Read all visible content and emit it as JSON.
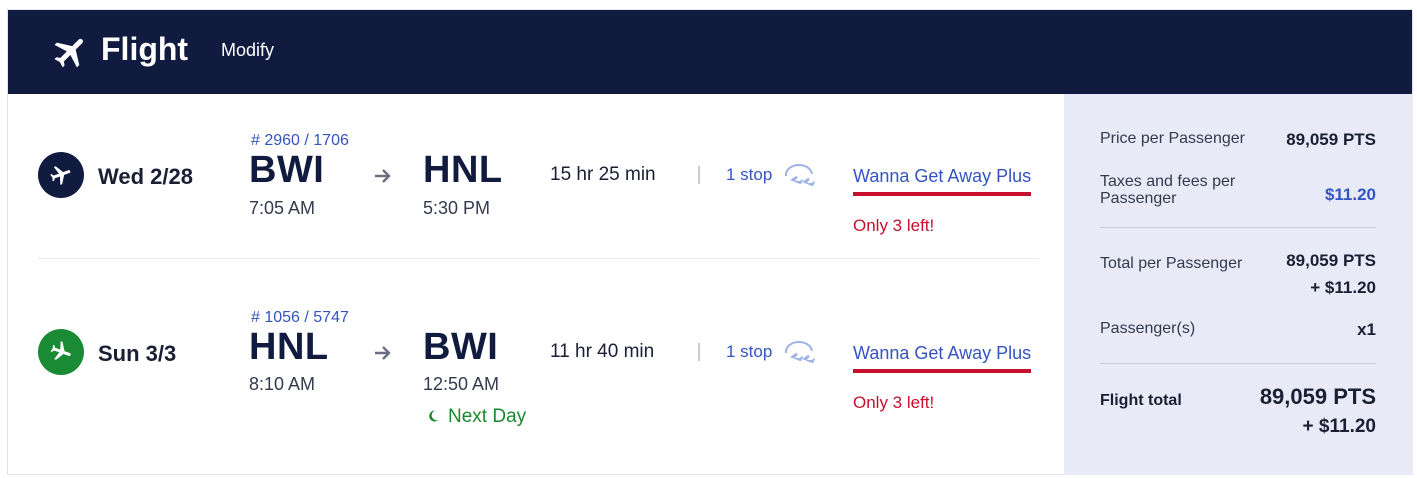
{
  "header": {
    "title": "Flight",
    "modify_label": "Modify",
    "icon": "airplane-icon"
  },
  "flights": [
    {
      "date": "Wed 2/28",
      "flight_number": "# 2960 / 1706",
      "origin": "BWI",
      "depart_time": "7:05 AM",
      "destination": "HNL",
      "arrive_time": "5:30 PM",
      "duration": "15 hr 25 min",
      "stops": "1 stop",
      "fare": "Wanna Get Away Plus",
      "seats_left": "Only 3 left!",
      "next_day": ""
    },
    {
      "date": "Sun 3/3",
      "flight_number": "# 1056 / 5747",
      "origin": "HNL",
      "depart_time": "8:10 AM",
      "destination": "BWI",
      "arrive_time": "12:50 AM",
      "duration": "11 hr 40 min",
      "stops": "1 stop",
      "fare": "Wanna Get Away Plus",
      "seats_left": "Only 3 left!",
      "next_day": "Next Day"
    }
  ],
  "summary": {
    "price_label": "Price per Passenger",
    "price_value": "89,059 PTS",
    "taxes_label": "Taxes and fees per Passenger",
    "taxes_value": "$11.20",
    "total_label": "Total per Passenger",
    "total_pts": "89,059 PTS",
    "total_cash": "+ $11.20",
    "passengers_label": "Passenger(s)",
    "passengers_value": "x1",
    "flight_total_label": "Flight total",
    "flight_total_pts": "89,059 PTS",
    "flight_total_cash": "+ $11.20"
  },
  "colors": {
    "header_bg": "#111b40",
    "depart_badge": "#111b40",
    "return_badge": "#1a8a35",
    "accent_blue": "#3455c0",
    "alert_red": "#c8102e",
    "summary_bg": "#e8eaf7"
  }
}
